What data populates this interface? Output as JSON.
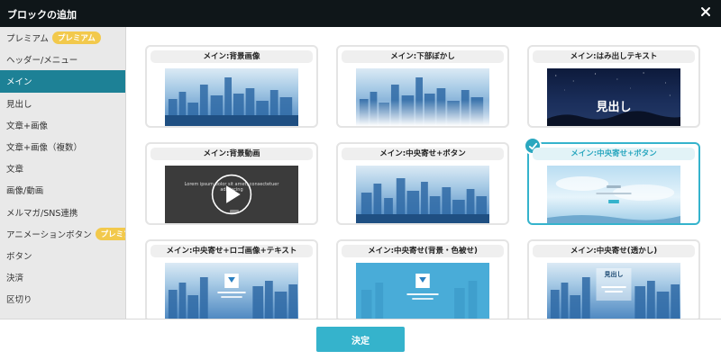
{
  "dialog": {
    "title": "ブロックの追加",
    "close_icon": "close-icon"
  },
  "sidebar": {
    "premium_badge": "プレミアム",
    "items": [
      {
        "label": "プレミアム",
        "premium": true
      },
      {
        "label": "ヘッダー/メニュー"
      },
      {
        "label": "メイン",
        "active": true
      },
      {
        "label": "見出し"
      },
      {
        "label": "文章+画像"
      },
      {
        "label": "文章+画像（複数）"
      },
      {
        "label": "文章"
      },
      {
        "label": "画像/動画"
      },
      {
        "label": "メルマガ/SNS連携"
      },
      {
        "label": "アニメーションボタン",
        "premium": true
      },
      {
        "label": "ボタン"
      },
      {
        "label": "決済"
      },
      {
        "label": "区切り"
      }
    ]
  },
  "blocks": [
    {
      "label": "メイン:背景画像",
      "thumb": "city"
    },
    {
      "label": "メイン:下部ぼかし",
      "thumb": "city-fade"
    },
    {
      "label": "メイン:はみ出しテキスト",
      "thumb": "night",
      "heading": "見出し"
    },
    {
      "label": "メイン:背景動画",
      "thumb": "video",
      "text": "Lorem ipsum dolor sit amet, consectetuer adipiscing"
    },
    {
      "label": "メイン:中央寄せ+ボタン",
      "thumb": "city"
    },
    {
      "label": "メイン:中央寄せ+ボタン",
      "thumb": "sky",
      "selected": true
    },
    {
      "label": "メイン:中央寄せ+ロゴ画像+テキスト",
      "thumb": "city-logo"
    },
    {
      "label": "メイン:中央寄せ(背景・色被せ)",
      "thumb": "teal"
    },
    {
      "label": "メイン:中央寄せ(透かし)",
      "thumb": "city-box",
      "heading": "見出し"
    }
  ],
  "footer": {
    "decide_label": "決定"
  },
  "colors": {
    "accent": "#35b3cc",
    "sidebar_active": "#1d8196",
    "premium": "#f2c94c",
    "titlebar": "#0f1619"
  }
}
